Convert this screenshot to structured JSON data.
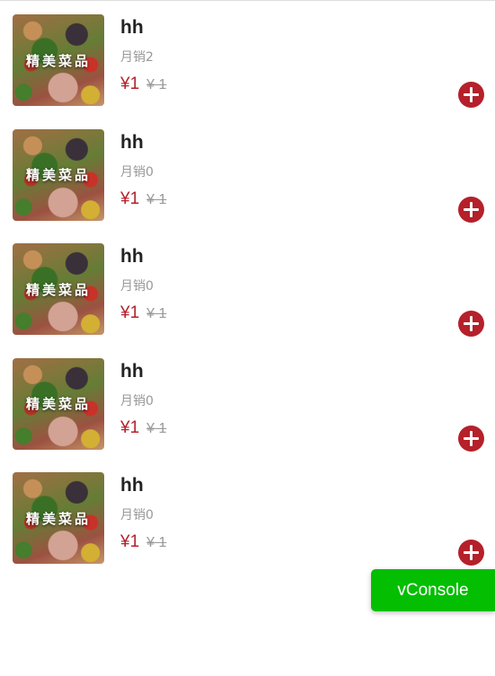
{
  "products": [
    {
      "thumb_label": "精美菜品",
      "name": "hh",
      "sales": "月销2",
      "price": "¥1",
      "old_price": "¥ 1"
    },
    {
      "thumb_label": "精美菜品",
      "name": "hh",
      "sales": "月销0",
      "price": "¥1",
      "old_price": "¥ 1"
    },
    {
      "thumb_label": "精美菜品",
      "name": "hh",
      "sales": "月销0",
      "price": "¥1",
      "old_price": "¥ 1"
    },
    {
      "thumb_label": "精美菜品",
      "name": "hh",
      "sales": "月销0",
      "price": "¥1",
      "old_price": "¥ 1"
    },
    {
      "thumb_label": "精美菜品",
      "name": "hh",
      "sales": "月销0",
      "price": "¥1",
      "old_price": "¥ 1"
    }
  ],
  "add_icon": "plus-circle-icon",
  "vconsole": {
    "label": "vConsole"
  },
  "colors": {
    "price": "#b5202a",
    "add_button": "#b5202a",
    "vconsole": "#04be02"
  }
}
